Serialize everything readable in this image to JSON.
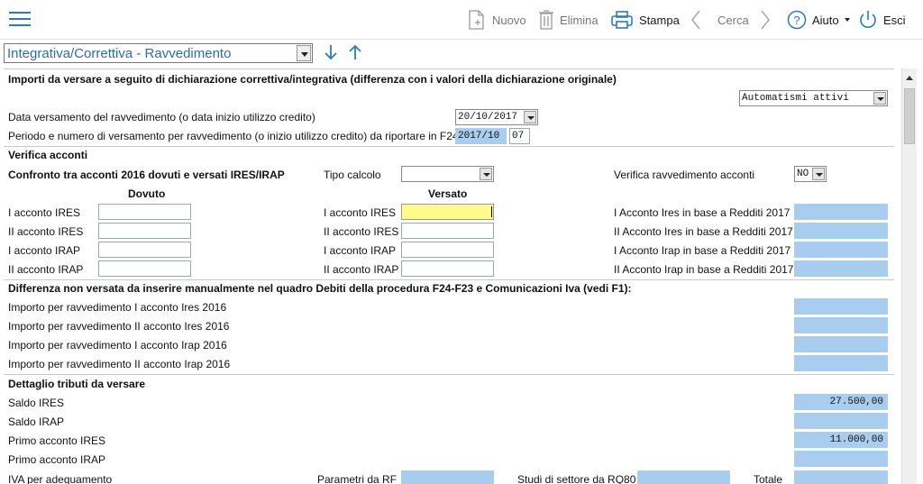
{
  "toolbar": {
    "nuovo": "Nuovo",
    "elimina": "Elimina",
    "stampa": "Stampa",
    "cerca": "Cerca",
    "aiuto": "Aiuto",
    "esci": "Esci"
  },
  "selector": {
    "value": "Integrativa/Correttiva - Ravvedimento"
  },
  "form": {
    "header": "Importi da versare a seguito di dichiarazione correttiva/integrativa (differenza con i valori della dichiarazione originale)",
    "automatismi": "Automatismi attivi",
    "data_label": "Data versamento del ravvedimento (o data inizio utilizzo credito)",
    "data_value": "20/10/2017",
    "periodo_label": "Periodo e numero di versamento per ravvedimento (o inizio utilizzo credito) da riportare in F24",
    "periodo_value": "2017/10",
    "numero_value": "07",
    "verifica_title": "Verifica acconti",
    "confronto_label": "Confronto tra acconti 2016 dovuti e versati IRES/IRAP",
    "tipo_calcolo_label": "Tipo calcolo",
    "verifica_rav_label": "Verifica ravvedimento acconti",
    "verifica_rav_value": "NO",
    "dovuto_header": "Dovuto",
    "versato_header": "Versato",
    "acconti_rows": [
      {
        "dovuto_label": "I acconto IRES",
        "versato_label": "I acconto IRES",
        "redditi_label": "I Acconto Ires in base a Redditi 2017"
      },
      {
        "dovuto_label": "II acconto IRES",
        "versato_label": "II acconto IRES",
        "redditi_label": "II Acconto Ires in base a Redditi 2017"
      },
      {
        "dovuto_label": "I acconto IRAP",
        "versato_label": "I acconto IRAP",
        "redditi_label": "I Acconto Irap in base a Redditi 2017"
      },
      {
        "dovuto_label": "II acconto IRAP",
        "versato_label": "II acconto IRAP",
        "redditi_label": "II Acconto Irap in base a Redditi 2017"
      }
    ],
    "differenza_title": "Differenza non versata da inserire manualmente nel quadro Debiti della procedura F24-F23 e Comunicazioni Iva (vedi F1):",
    "importi_rows": [
      "Importo per ravvedimento I acconto Ires 2016",
      "Importo per ravvedimento II acconto Ires 2016",
      "Importo per ravvedimento I acconto Irap 2016",
      "Importo per ravvedimento II acconto Irap 2016"
    ],
    "dettaglio_title": "Dettaglio tributi da versare",
    "dettaglio_rows": [
      {
        "label": "Saldo IRES",
        "value": "27.500,00"
      },
      {
        "label": "Saldo IRAP",
        "value": ""
      },
      {
        "label": "Primo acconto IRES",
        "value": "11.000,00"
      },
      {
        "label": "Primo acconto IRAP",
        "value": ""
      }
    ],
    "iva_label": "IVA per adeguamento",
    "parametri_label": "Parametri da RF",
    "studi_label": "Studi di settore da RQ80",
    "totale_label": "Totale"
  },
  "colors": {
    "accent": "#2a7ac3",
    "field_blue": "#a9cdee",
    "field_yellow": "#fffb8c"
  }
}
